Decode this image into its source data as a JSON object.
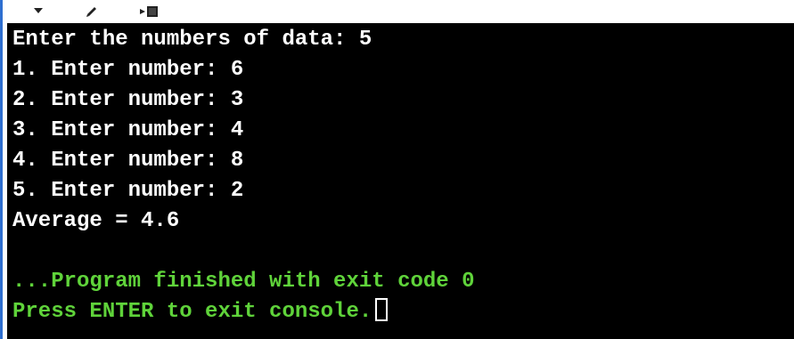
{
  "toolbar": {
    "icons": [
      "chevron-down-icon",
      "pencil-icon",
      "terminal-icon"
    ]
  },
  "console": {
    "lines_top": [
      "Enter the numbers of data: 5",
      "1. Enter number: 6",
      "2. Enter number: 3",
      "3. Enter number: 4",
      "4. Enter number: 8",
      "5. Enter number: 2",
      "Average = 4.6"
    ],
    "status_line": "...Program finished with exit code 0",
    "prompt_line": "Press ENTER to exit console."
  },
  "colors": {
    "background": "#000000",
    "text": "#ffffff",
    "status": "#5fd33a",
    "accent": "#2e6fd0"
  }
}
